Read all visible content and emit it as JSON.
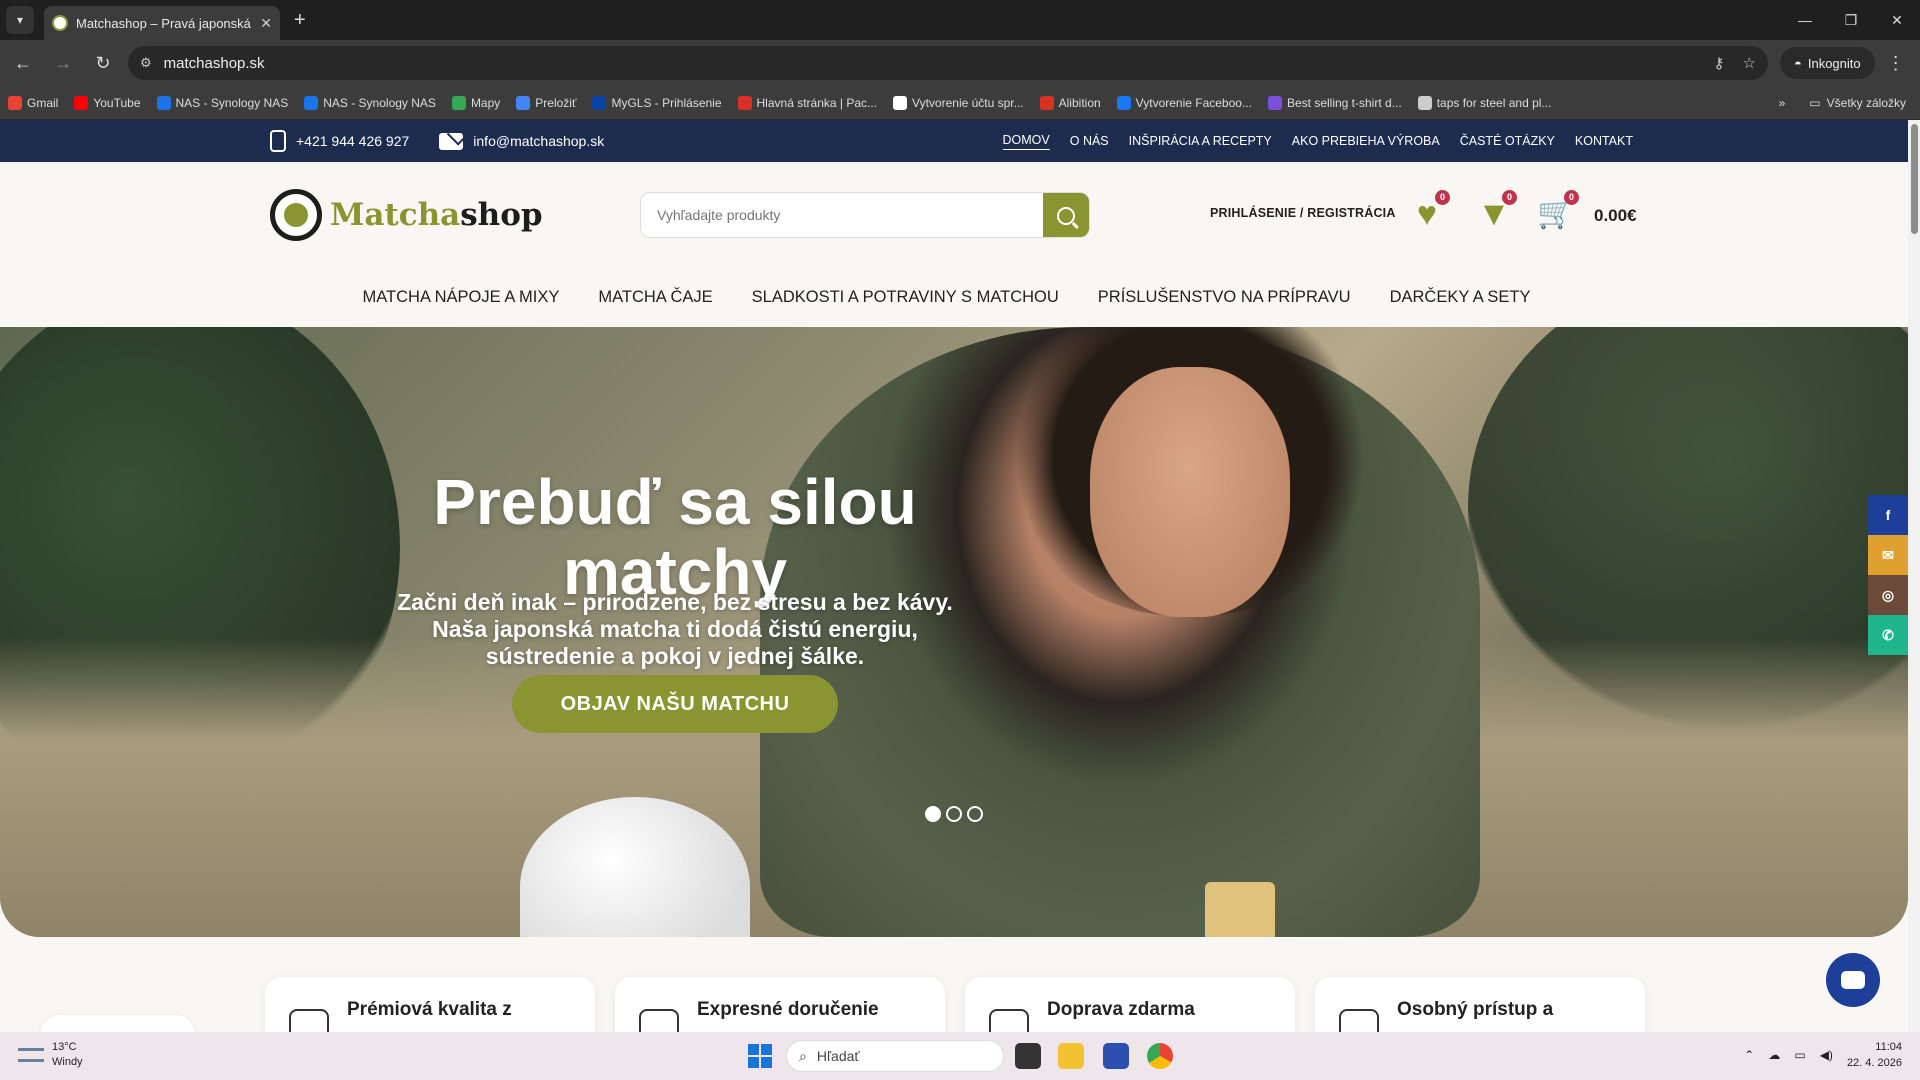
{
  "browser": {
    "tab_title": "Matchashop – Pravá japonská m",
    "tab_close": "✕",
    "new_tab": "+",
    "url": "matchashop.sk",
    "incognito_label": "Inkognito",
    "controls": {
      "minimize": "—",
      "restore": "❐",
      "close": "✕"
    },
    "bookmarks": [
      {
        "label": "Gmail",
        "color": "#ea4335"
      },
      {
        "label": "YouTube",
        "color": "#ff0000"
      },
      {
        "label": "NAS - Synology NAS",
        "color": "#1a73e8"
      },
      {
        "label": "NAS - Synology NAS",
        "color": "#1a73e8"
      },
      {
        "label": "Mapy",
        "color": "#34a853"
      },
      {
        "label": "Preložiť",
        "color": "#4285f4"
      },
      {
        "label": "MyGLS - Prihlásenie",
        "color": "#0b3fa3"
      },
      {
        "label": "Hlavná stránka | Pac...",
        "color": "#d93025"
      },
      {
        "label": "Vytvorenie účtu spr...",
        "color": "#ffffff"
      },
      {
        "label": "Alibition",
        "color": "#d93025"
      },
      {
        "label": "Vytvorenie Faceboo...",
        "color": "#1877f2"
      },
      {
        "label": "Best selling t-shirt d...",
        "color": "#7b4fd9"
      },
      {
        "label": "taps for steel and pl...",
        "color": "#cccccc"
      }
    ],
    "bookmarks_more": "»",
    "all_bookmarks": "Všetky záložky"
  },
  "site": {
    "phone": "+421 944 426 927",
    "email": "info@matchashop.sk",
    "top_nav": [
      "DOMOV",
      "O NÁS",
      "INŠPIRÁCIA A RECEPTY",
      "AKO PREBIEHA VÝROBA",
      "ČASTÉ OTÁZKY",
      "KONTAKT"
    ],
    "logo_green": "Matcha",
    "logo_dark": "shop",
    "search_placeholder": "Vyhľadajte produkty",
    "account": "PRIHLÁSENIE / REGISTRÁCIA",
    "wishlist_count": "0",
    "compare_count": "0",
    "cart_count": "0",
    "cart_total": "0.00€",
    "categories": [
      "MATCHA NÁPOJE A MIXY",
      "MATCHA ČAJE",
      "SLADKOSTI A POTRAVINY S MATCHOU",
      "PRÍSLUŠENSTVO NA PRÍPRAVU",
      "DARČEKY A SETY"
    ],
    "hero": {
      "title": "Prebuď sa silou matchy",
      "subtitle": "Začni deň inak – prirodzene, bez stresu a bez kávy. Naša japonská matcha ti dodá čistú energiu, sústredenie a pokoj v jednej šálke.",
      "cta": "OBJAV NAŠU MATCHU",
      "slides": 3,
      "active_slide": 1
    },
    "social": [
      {
        "name": "facebook",
        "glyph": "f",
        "color": "#1d3f9a"
      },
      {
        "name": "email",
        "glyph": "✉",
        "color": "#e0a02f"
      },
      {
        "name": "instagram",
        "glyph": "◎",
        "color": "#6b4a3a"
      },
      {
        "name": "whatsapp",
        "glyph": "✆",
        "color": "#1eb58f"
      }
    ],
    "features": [
      "Prémiová kvalita z",
      "Expresné doručenie",
      "Doprava zdarma",
      "Osobný prístup a"
    ],
    "accent_color": "#8a9431",
    "navy_color": "#1d2b4f"
  },
  "taskbar": {
    "temperature": "13°C",
    "weather": "Windy",
    "search": "Hľadať",
    "time": "11:04",
    "date": "22. 4. 2026"
  }
}
